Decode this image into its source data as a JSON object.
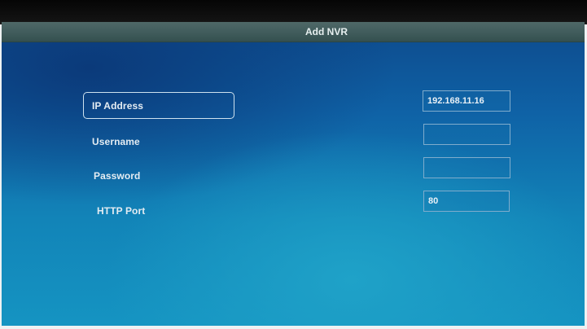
{
  "dialog": {
    "title": "Add NVR"
  },
  "form": {
    "fields": [
      {
        "label": "IP Address",
        "value": "192.168.11.16",
        "focused": true
      },
      {
        "label": "Username",
        "value": ""
      },
      {
        "label": "Password",
        "value": ""
      },
      {
        "label": "HTTP Port",
        "value": "80"
      }
    ]
  },
  "colors": {
    "background_top": "#0d4a8c",
    "background_bottom": "#1594c2",
    "title_bar": "#3f5a5a",
    "text": "#e4ecf2"
  }
}
